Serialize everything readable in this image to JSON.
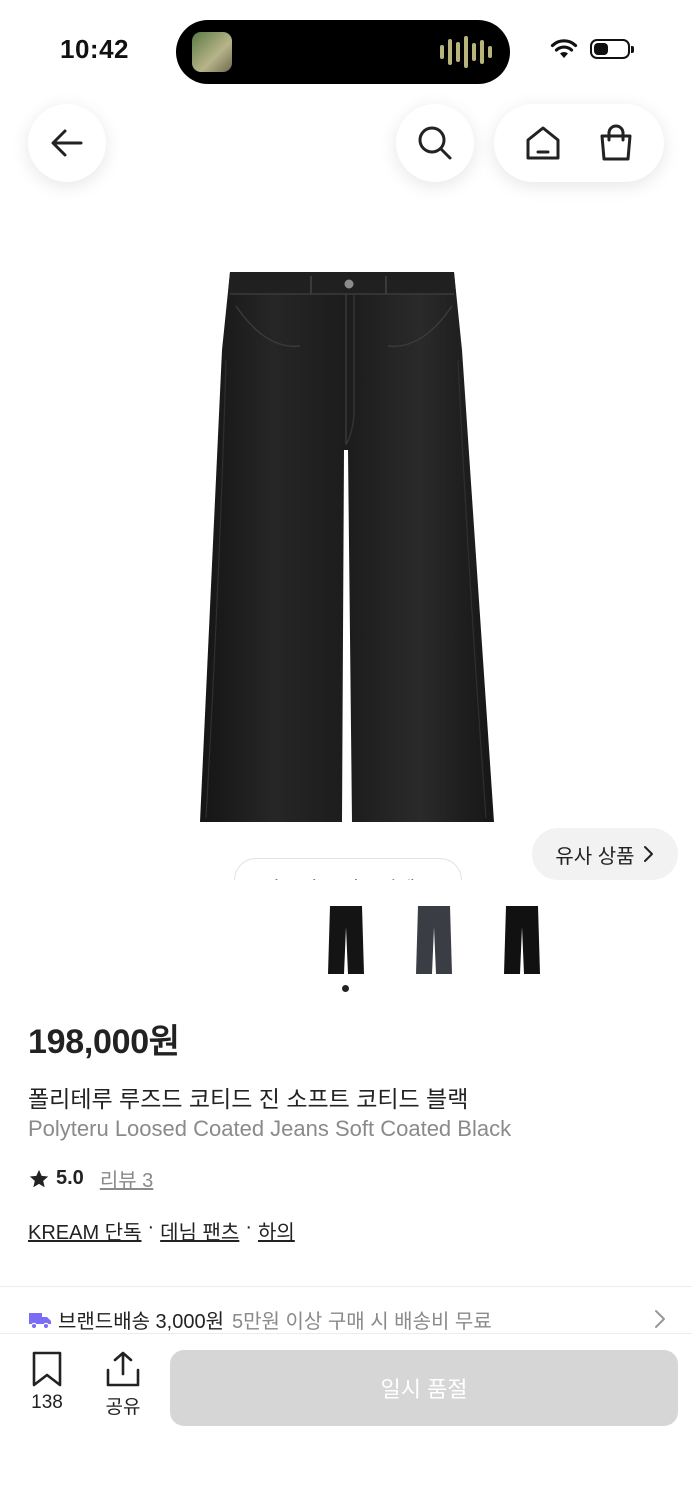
{
  "status_bar": {
    "time": "10:42",
    "battery_level": 0.45
  },
  "nav": {
    "icons": [
      "arrow-left-icon",
      "search-icon",
      "home-icon",
      "shopping-bag-icon"
    ]
  },
  "media": {
    "similar_label": "유사 상품",
    "tooltip_partial": "사고싶은 상품이에요",
    "thumbnail_count": 3,
    "active_index": 0
  },
  "product": {
    "price": "198,000원",
    "name_ko": "폴리테루 루즈드 코티드 진 소프트 코티드 블랙",
    "name_en": "Polyteru Loosed Coated Jeans Soft Coated Black",
    "rating": "5.0",
    "review_label": "리뷰 3",
    "tags": [
      "KREAM 단독",
      "데님 팬츠",
      "하의"
    ]
  },
  "shipping": {
    "label": "브랜드배송 3,000원",
    "note": "5만원 이상 구매 시 배송비 무료"
  },
  "bottom_bar": {
    "bookmark_count": "138",
    "share_label": "공유",
    "buy_label": "일시 품절"
  },
  "colors": {
    "accent": "#7b6cf6",
    "disabled_button": "#d6d6d6"
  }
}
